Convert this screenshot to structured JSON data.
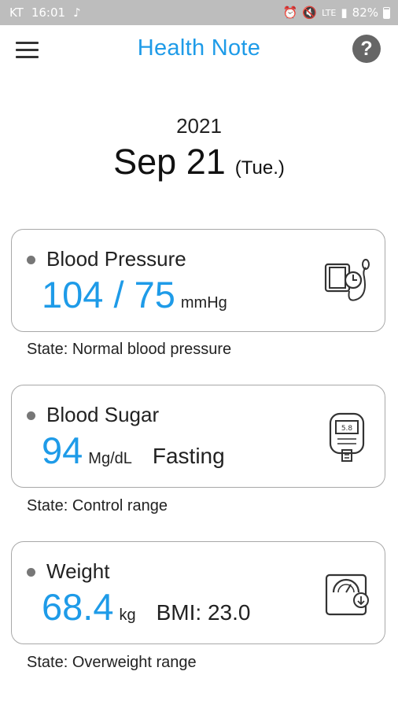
{
  "status_bar": {
    "carrier": "KT",
    "time": "16:01",
    "network": "LTE",
    "battery": "82%"
  },
  "header": {
    "title": "Health Note"
  },
  "date": {
    "year": "2021",
    "date": "Sep 21",
    "weekday": "(Tue.)"
  },
  "cards": [
    {
      "label": "Blood Pressure",
      "value": "104 / 75",
      "unit": "mmHg",
      "extra": "",
      "state": "State: Normal blood pressure",
      "icon": "blood-pressure-monitor-icon"
    },
    {
      "label": "Blood Sugar",
      "value": "94",
      "unit": "Mg/dL",
      "extra": "Fasting",
      "state": "State: Control range",
      "icon": "glucose-meter-icon",
      "meter_reading": "5.8"
    },
    {
      "label": "Weight",
      "value": "68.4",
      "unit": "kg",
      "extra": "BMI: 23.0",
      "state": "State: Overweight range",
      "icon": "weight-scale-icon"
    }
  ],
  "colors": {
    "accent": "#1e9be8",
    "status_bar": "#bdbdbd",
    "card_border": "#a8a8a8"
  }
}
